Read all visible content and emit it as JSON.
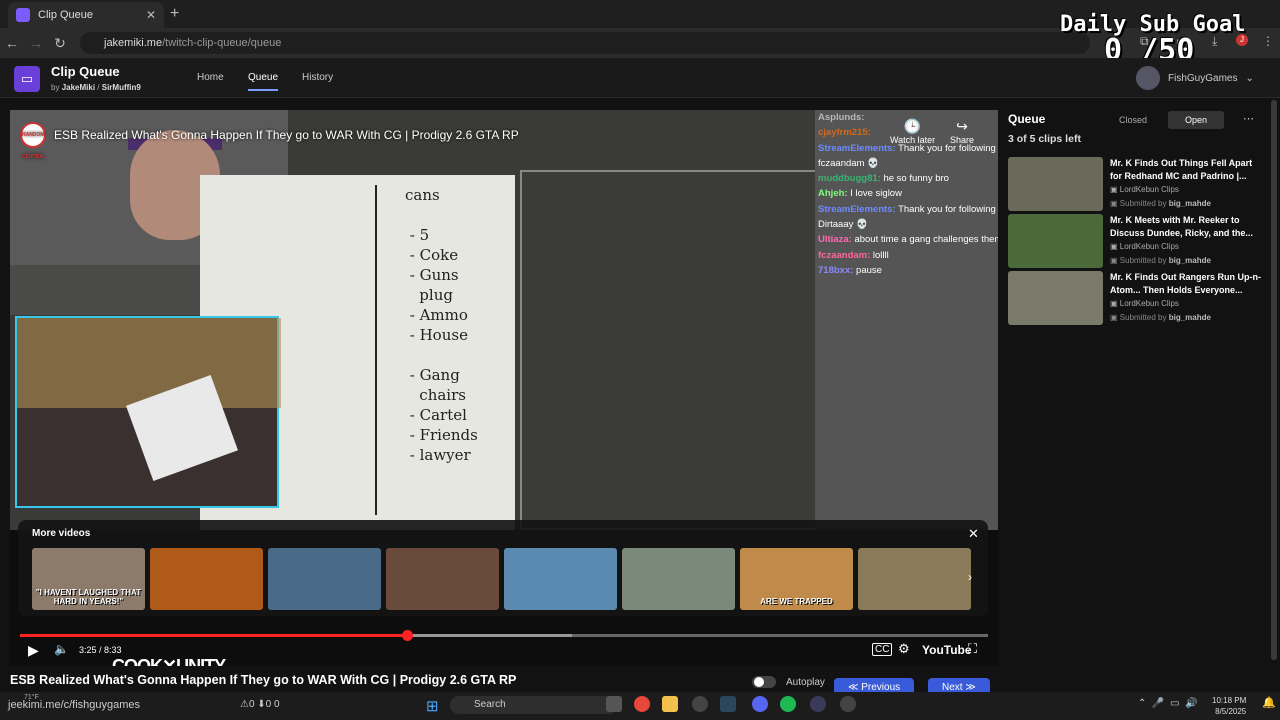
{
  "browser": {
    "tab_title": "Clip Queue",
    "url_host": "jakemiki.me",
    "url_path": "/twitch-clip-queue/queue"
  },
  "overlay": {
    "goal_title": "Daily Sub Goal",
    "goal_count": "0 /50"
  },
  "app": {
    "title": "Clip Queue",
    "by": "by",
    "author1": "JakeMiki",
    "sep": "/",
    "author2": "SirMuffin9",
    "nav": [
      "Home",
      "Queue",
      "History"
    ],
    "user": "FishGuyGames"
  },
  "player": {
    "video_title": "ESB Realized What's Gonna Happen If They go to WAR With CG | Prodigy 2.6 GTA RP",
    "channel_badge": "RANDOM CENTRAL",
    "watch_later": "Watch later",
    "share": "Share",
    "whiteboard_text": "cans\n\n - 5\n - Coke\n - Guns\n   plug\n - Ammo\n - House\n\n - Gang\n   chairs\n - Cartel\n - Friends\n - lawyer",
    "chat": [
      {
        "name": "Asplunds:",
        "msg": "",
        "color": "#b8b8b8"
      },
      {
        "name": "cjayfrm215:",
        "msg": "",
        "color": "#d2691e"
      },
      {
        "name": "StreamElements:",
        "msg": "Thank you for following fczaandam 💀",
        "color": "#6d8cff"
      },
      {
        "name": "muddbugg81:",
        "msg": "he so funny bro",
        "color": "#3cb371"
      },
      {
        "name": "Ahjeh:",
        "msg": "I love siglow",
        "color": "#7fff7f"
      },
      {
        "name": "StreamElements:",
        "msg": "Thank you for following Dirtaaay 💀",
        "color": "#6d8cff"
      },
      {
        "name": "Ultiaza:",
        "msg": "about time a gang challenges them",
        "color": "#ff69b4"
      },
      {
        "name": "fczaandam:",
        "msg": "lollll",
        "color": "#ff6699"
      },
      {
        "name": "718bxx:",
        "msg": "pause",
        "color": "#8a8aff"
      }
    ],
    "more_videos_label": "More videos",
    "more_videos": [
      {
        "color": "#8c7a6a"
      },
      {
        "color": "#b05a1a"
      },
      {
        "color": "#4a6a8a"
      },
      {
        "color": "#6a4a3a"
      },
      {
        "color": "#5a8ab0"
      },
      {
        "color": "#7a8a7a"
      },
      {
        "color": "#c08a4a"
      },
      {
        "color": "#8a7a5a"
      }
    ],
    "thumb1_caption": "\"I HAVENT LAUGHED THAT HARD IN YEARS!\"",
    "thumb7_caption": "ARE WE TRAPPED",
    "time": "3:25 / 8:33",
    "progress": 0.4,
    "buffered": 0.57,
    "youtube_label": "YouTube",
    "sponsor": "COOK✕UNITY"
  },
  "below": {
    "title": "ESB Realized What's Gonna Happen If They go to WAR With CG | Prodigy 2.6 GTA RP",
    "autoplay": "Autoplay",
    "previous": "≪ Previous",
    "next": "Next ≫"
  },
  "queue": {
    "title": "Queue",
    "count": "3 of 5 clips left",
    "tab_closed": "Closed",
    "tab_open": "Open",
    "items": [
      {
        "title": "Mr. K Finds Out Things Fell Apart for Redhand MC and Padrino |...",
        "channel": "LordKebun Clips",
        "submitted": "Submitted by",
        "submitter": "big_mahde",
        "color": "#6a6a5a"
      },
      {
        "title": "Mr. K Meets with Mr. Reeker to Discuss Dundee, Ricky, and the...",
        "channel": "LordKebun Clips",
        "submitted": "Submitted by",
        "submitter": "big_mahde",
        "color": "#4a6a3a"
      },
      {
        "title": "Mr. K Finds Out Rangers Run Up-n-Atom... Then Holds Everyone...",
        "channel": "LordKebun Clips",
        "submitted": "Submitted by",
        "submitter": "big_mahde",
        "color": "#7a7a6a"
      }
    ]
  },
  "taskbar": {
    "status_url": "jeekimi.me/c/fishguygames",
    "weather": "71°F",
    "search": "Search",
    "left_stats": "⚠0  ⬇0  0",
    "time": "10:18 PM",
    "date": "8/5/2025"
  }
}
